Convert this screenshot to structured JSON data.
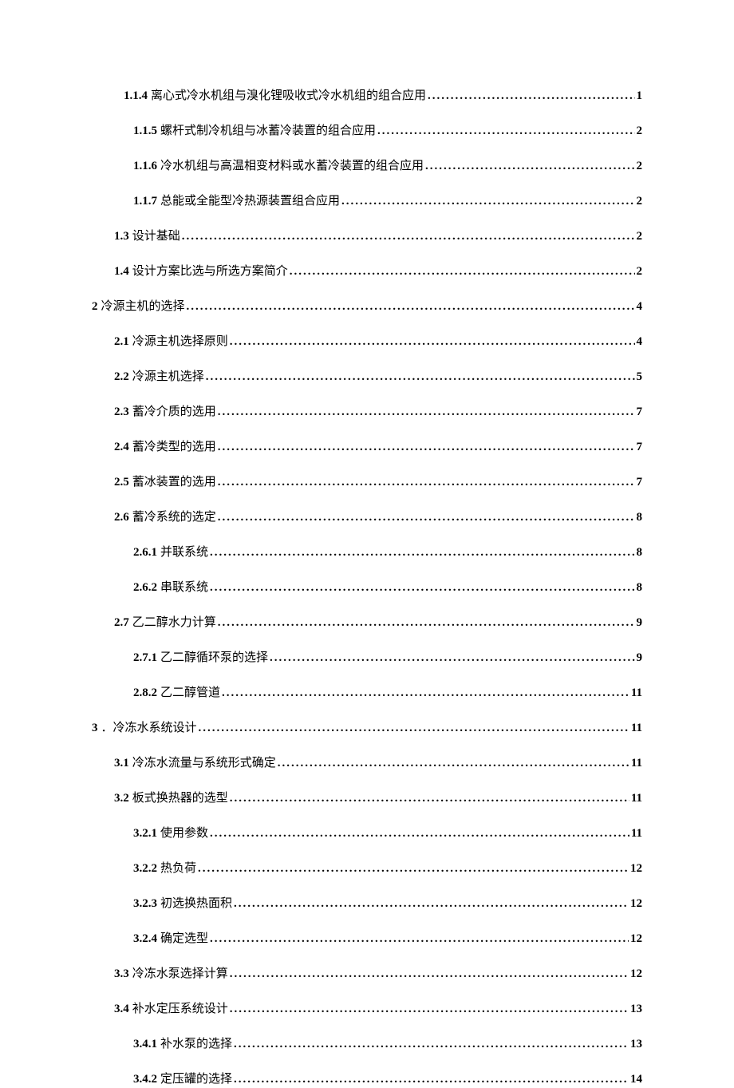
{
  "toc": [
    {
      "num": "1.1.4",
      "title": "离心式冷水机组与溴化锂吸收式冷水机组的组合应用",
      "page": "1",
      "indent": "lvl-3"
    },
    {
      "num": "1.1.5",
      "title": "螺杆式制冷机组与冰蓄冷装置的组合应用",
      "page": "2",
      "indent": "lvl-3b"
    },
    {
      "num": "1.1.6",
      "title": "冷水机组与高温相变材料或水蓄冷装置的组合应用",
      "page": "2",
      "indent": "lvl-3b"
    },
    {
      "num": "1.1.7",
      "title": "总能或全能型冷热源装置组合应用",
      "page": "2",
      "indent": "lvl-3b"
    },
    {
      "num": "1.3",
      "title": "设计基础",
      "page": "2",
      "indent": "lvl-2"
    },
    {
      "num": "1.4",
      "title": "设计方案比选与所选方案简介",
      "page": "2",
      "indent": "lvl-2"
    },
    {
      "num": "2",
      "title": "冷源主机的选择",
      "page": "4",
      "indent": "lvl-1"
    },
    {
      "num": "2.1",
      "title": "冷源主机选择原则",
      "page": "4",
      "indent": "lvl-2"
    },
    {
      "num": "2.2",
      "title": "冷源主机选择",
      "page": "5",
      "indent": "lvl-2"
    },
    {
      "num": "2.3",
      "title": "蓄冷介质的选用",
      "page": "7",
      "indent": "lvl-2"
    },
    {
      "num": "2.4",
      "title": "蓄冷类型的选用",
      "page": "7",
      "indent": "lvl-2"
    },
    {
      "num": "2.5",
      "title": "蓄冰装置的选用",
      "page": "7",
      "indent": "lvl-2"
    },
    {
      "num": "2.6",
      "title": "蓄冷系统的选定",
      "page": "8",
      "indent": "lvl-2"
    },
    {
      "num": "2.6.1",
      "title": "并联系统",
      "page": "8",
      "indent": "lvl-3b"
    },
    {
      "num": "2.6.2",
      "title": "串联系统",
      "page": "8",
      "indent": "lvl-3b"
    },
    {
      "num": "2.7",
      "title": "乙二醇水力计算",
      "page": "9",
      "indent": "lvl-2"
    },
    {
      "num": "2.7.1",
      "title": "乙二醇循环泵的选择",
      "page": "9",
      "indent": "lvl-3b"
    },
    {
      "num": "2.8.2",
      "title": "乙二醇管道",
      "page": "11",
      "indent": "lvl-3b"
    },
    {
      "num": "3",
      "title": "．冷冻水系统设计",
      "page": "11",
      "indent": "lvl-1"
    },
    {
      "num": "3.1",
      "title": "冷冻水流量与系统形式确定",
      "page": "11",
      "indent": "lvl-2"
    },
    {
      "num": "3.2",
      "title": "板式换热器的选型",
      "page": "11",
      "indent": "lvl-2"
    },
    {
      "num": "3.2.1",
      "title": "使用参数",
      "page": "11",
      "indent": "lvl-3b"
    },
    {
      "num": "3.2.2",
      "title": "热负荷",
      "page": "12",
      "indent": "lvl-3b"
    },
    {
      "num": "3.2.3",
      "title": "初选换热面积",
      "page": "12",
      "indent": "lvl-3b"
    },
    {
      "num": "3.2.4",
      "title": "确定选型",
      "page": "12",
      "indent": "lvl-3b"
    },
    {
      "num": "3.3",
      "title": "冷冻水泵选择计算",
      "page": "12",
      "indent": "lvl-2"
    },
    {
      "num": "3.4",
      "title": "补水定压系统设计",
      "page": "13",
      "indent": "lvl-2"
    },
    {
      "num": "3.4.1",
      "title": "补水泵的选择",
      "page": "13",
      "indent": "lvl-3b"
    },
    {
      "num": "3.4.2",
      "title": "定压罐的选择",
      "page": "14",
      "indent": "lvl-3b"
    }
  ]
}
